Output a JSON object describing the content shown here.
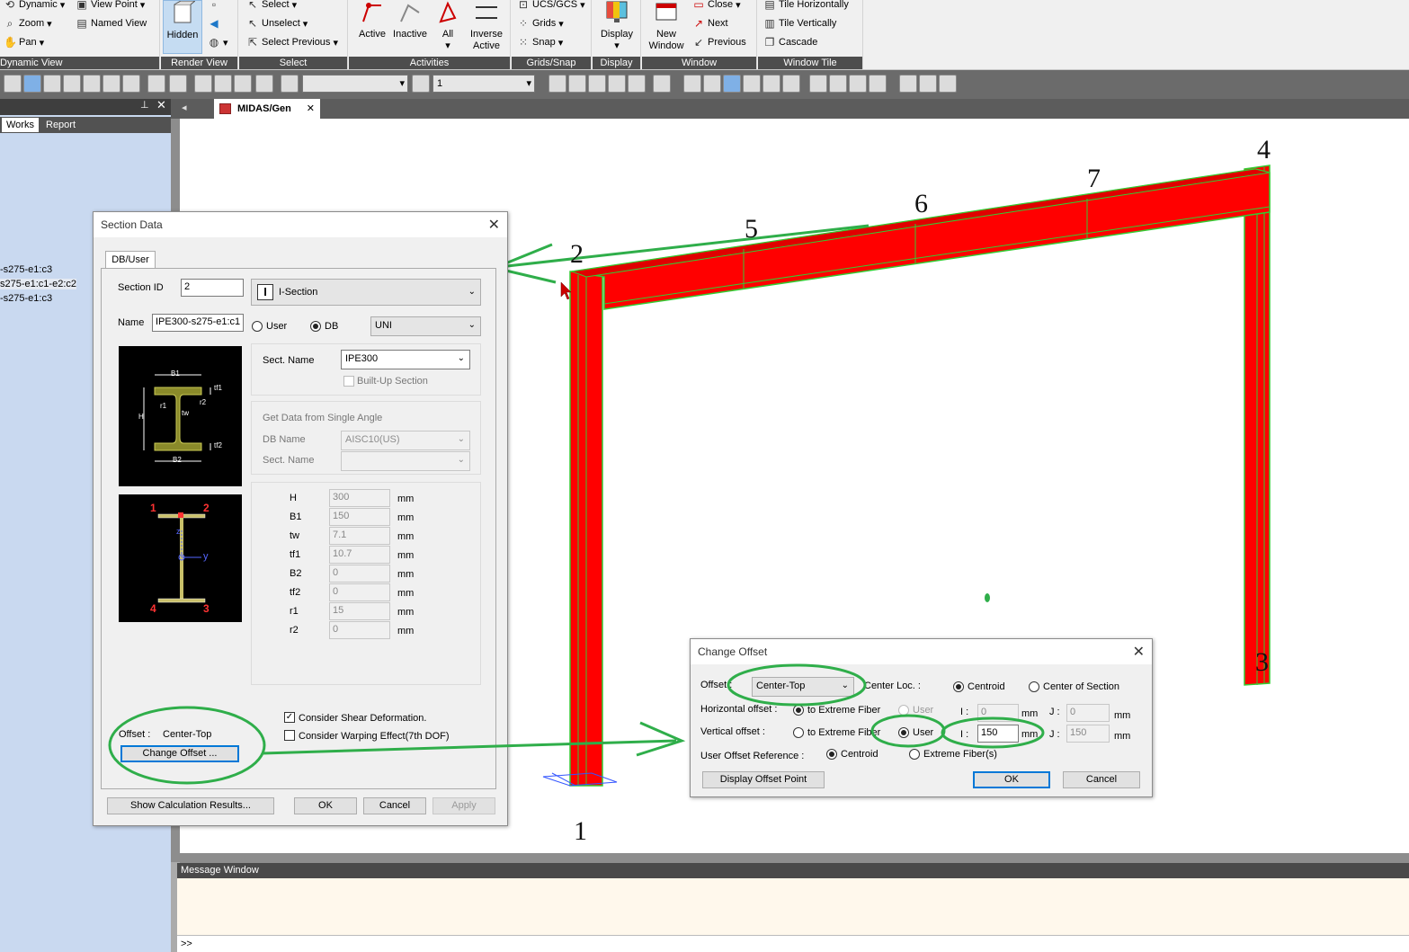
{
  "ribbon": {
    "dynamic_view": {
      "dynamic": "Dynamic",
      "view_point": "View Point",
      "zoom": "Zoom",
      "named_view": "Named View",
      "pan": "Pan",
      "title": "Dynamic View"
    },
    "render_view": {
      "hidden": "Hidden",
      "title": "Render View"
    },
    "select": {
      "select": "Select",
      "unselect": "Unselect",
      "select_previous": "Select Previous",
      "title": "Select"
    },
    "activities": {
      "active": "Active",
      "inactive": "Inactive",
      "all": "All",
      "inverse_active": "Inverse Active",
      "title": "Activities"
    },
    "grids_snap": {
      "ucs_gcs": "UCS/GCS",
      "grids": "Grids",
      "snap": "Snap",
      "title": "Grids/Snap"
    },
    "display": {
      "display": "Display",
      "title": "Display"
    },
    "window": {
      "new_window": "New Window",
      "close": "Close",
      "next": "Next",
      "previous": "Previous",
      "title": "Window"
    },
    "window_tile": {
      "tile_horizontally": "Tile Horizontally",
      "tile_vertically": "Tile Vertically",
      "cascade": "Cascade",
      "title": "Window Tile"
    }
  },
  "toolbar": {
    "combo1_value": "",
    "combo2_value": "1"
  },
  "left_panel": {
    "tabs": [
      "Works",
      "Report"
    ],
    "items": [
      "-s275-e1:c3",
      "s275-e1:c1-e2:c2",
      "-s275-e1:c3"
    ]
  },
  "document": {
    "tab_label": "MIDAS/Gen"
  },
  "viewport": {
    "node_labels": [
      "1",
      "2",
      "3",
      "4",
      "5",
      "6",
      "7"
    ]
  },
  "section_data": {
    "title": "Section Data",
    "tab": "DB/User",
    "section_id_label": "Section ID",
    "section_id": "2",
    "section_type": "I-Section",
    "name_label": "Name",
    "name": "IPE300-s275-e1:c1",
    "user_label": "User",
    "db_label": "DB",
    "db_value": "UNI",
    "sect_name_label": "Sect. Name",
    "sect_name": "IPE300",
    "built_up_label": "Built-Up Section",
    "single_angle_title": "Get Data from Single Angle",
    "db_name_label": "DB Name",
    "db_name": "AISC10(US)",
    "sect_name2_label": "Sect. Name",
    "dims": [
      {
        "label": "H",
        "value": "300",
        "unit": "mm"
      },
      {
        "label": "B1",
        "value": "150",
        "unit": "mm"
      },
      {
        "label": "tw",
        "value": "7.1",
        "unit": "mm"
      },
      {
        "label": "tf1",
        "value": "10.7",
        "unit": "mm"
      },
      {
        "label": "B2",
        "value": "0",
        "unit": "mm"
      },
      {
        "label": "tf2",
        "value": "0",
        "unit": "mm"
      },
      {
        "label": "r1",
        "value": "15",
        "unit": "mm"
      },
      {
        "label": "r2",
        "value": "0",
        "unit": "mm"
      }
    ],
    "sketch_labels": {
      "b1": "B1",
      "b2": "B2",
      "h": "H",
      "tf1": "tf1",
      "tf2": "tf2",
      "r1": "r1",
      "r2": "r2",
      "tw": "tw"
    },
    "corner_labels": {
      "c1": "1",
      "c2": "2",
      "c3": "3",
      "c4": "4",
      "z": "z",
      "y": "y"
    },
    "offset_label": "Offset :",
    "offset_value": "Center-Top",
    "change_offset": "Change Offset ...",
    "shear_label": "Consider Shear Deformation.",
    "warping_label": "Consider Warping Effect(7th DOF)",
    "show_calc": "Show Calculation Results...",
    "ok": "OK",
    "cancel": "Cancel",
    "apply": "Apply"
  },
  "change_offset": {
    "title": "Change Offset",
    "offset_label": "Offset :",
    "offset_value": "Center-Top",
    "center_loc_label": "Center Loc. :",
    "centroid": "Centroid",
    "center_of_section": "Center of Section",
    "horizontal_label": "Horizontal offset :",
    "to_extreme_fiber": "to Extreme Fiber",
    "user": "User",
    "h_i_label": "I :",
    "h_i": "0",
    "h_j_label": "J :",
    "h_j": "0",
    "vertical_label": "Vertical offset :",
    "v_to_extreme": "to Extreme Fiber",
    "v_user": "User",
    "v_i_label": "I :",
    "v_i": "150",
    "v_j_label": "J :",
    "v_j": "150",
    "unit": "mm",
    "user_ref_label": "User Offset Reference :",
    "ref_centroid": "Centroid",
    "ref_extreme": "Extreme Fiber(s)",
    "display_point": "Display Offset Point",
    "ok": "OK",
    "cancel": "Cancel"
  },
  "message_window": {
    "title": "Message Window",
    "prompt": ">>"
  },
  "colors": {
    "member": "#ff0000",
    "edge": "#33cc33",
    "annotation": "#2fae4a",
    "accent": "#0078d7"
  }
}
